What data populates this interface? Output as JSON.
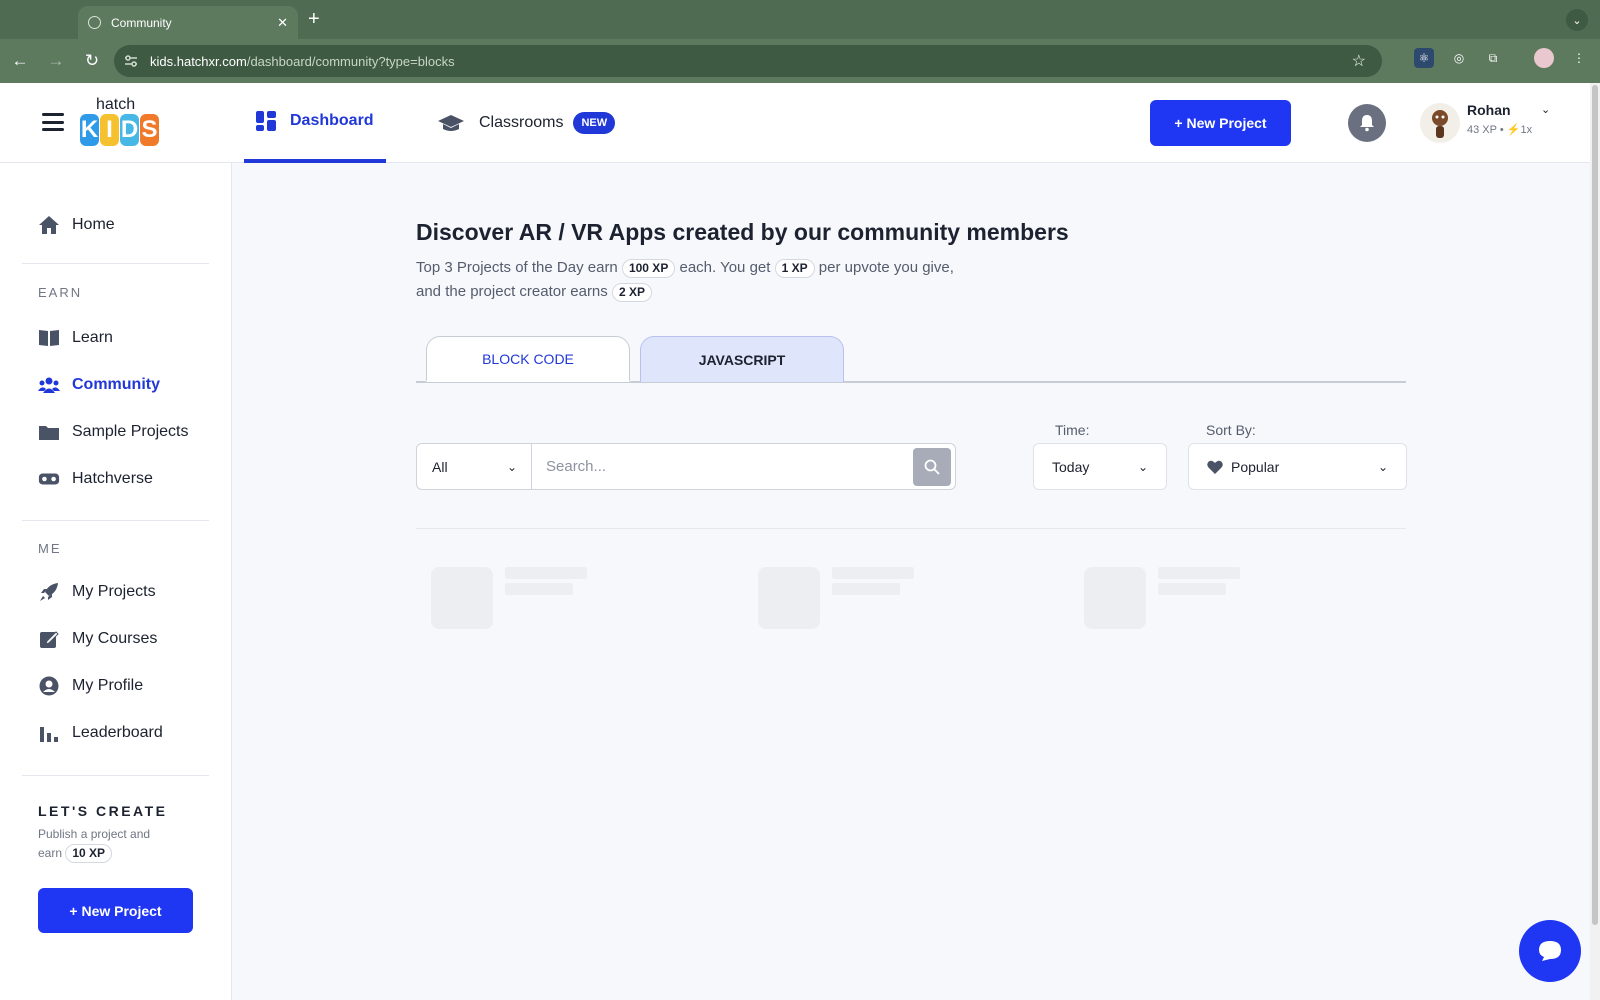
{
  "browser": {
    "tab_title": "Community",
    "url_host": "kids.hatchxr.com",
    "url_path": "/dashboard/community?type=blocks"
  },
  "header": {
    "logo_text": "hatch",
    "logo_kids": "KIDS",
    "nav": [
      {
        "label": "Dashboard",
        "icon": "dashboard-icon",
        "active": true
      },
      {
        "label": "Classrooms",
        "icon": "graduation-cap-icon",
        "badge": "NEW"
      }
    ],
    "new_project_label": "+ New Project",
    "user": {
      "name": "Rohan",
      "xp": "43 XP",
      "streak": "1x"
    }
  },
  "sidebar": {
    "home": {
      "label": "Home",
      "icon": "home-icon"
    },
    "earn_label": "EARN",
    "earn_items": [
      {
        "label": "Learn",
        "icon": "book-icon"
      },
      {
        "label": "Community",
        "icon": "users-icon",
        "active": true
      },
      {
        "label": "Sample Projects",
        "icon": "folder-icon"
      },
      {
        "label": "Hatchverse",
        "icon": "vr-headset-icon"
      }
    ],
    "me_label": "ME",
    "me_items": [
      {
        "label": "My Projects",
        "icon": "rocket-icon"
      },
      {
        "label": "My Courses",
        "icon": "edit-icon"
      },
      {
        "label": "My Profile",
        "icon": "user-icon"
      },
      {
        "label": "Leaderboard",
        "icon": "bar-chart-icon"
      }
    ],
    "create_title": "LET'S CREATE",
    "create_text_1": "Publish a project and",
    "create_text_2": "earn",
    "create_xp": "10 XP",
    "new_project_label": "+ New Project"
  },
  "main": {
    "title": "Discover AR / VR Apps created by our community members",
    "sub_1": "Top 3 Projects of the Day earn",
    "xp_1": "100 XP",
    "sub_2": "each. You get",
    "xp_2": "1 XP",
    "sub_3": "per upvote you give,",
    "sub_4": "and the project creator earns",
    "xp_3": "2 XP",
    "tabs": [
      {
        "label": "BLOCK CODE",
        "active": true
      },
      {
        "label": "JAVASCRIPT",
        "active": false
      }
    ],
    "filter_all": "All",
    "search_placeholder": "Search...",
    "time_label": "Time:",
    "time_value": "Today",
    "sort_label": "Sort By:",
    "sort_value": "Popular"
  },
  "colors": {
    "accent": "#1f36f2",
    "accent_text": "#2138d8",
    "browser_frame": "#5d7a5f"
  }
}
